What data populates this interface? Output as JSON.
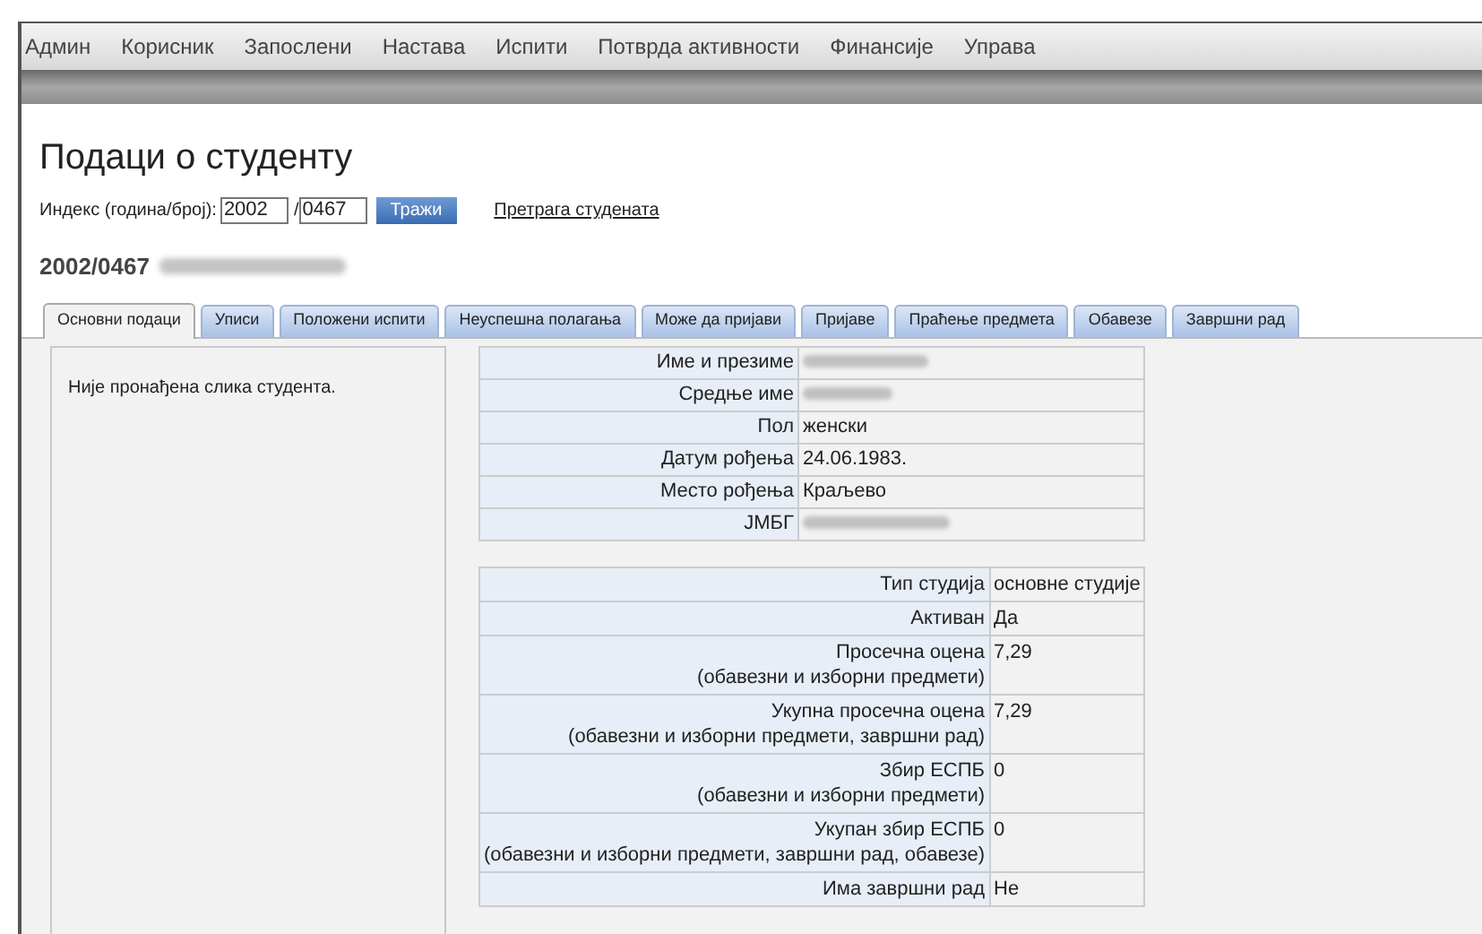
{
  "nav": [
    {
      "label": "Админ"
    },
    {
      "label": "Корисник"
    },
    {
      "label": "Запослени"
    },
    {
      "label": "Настава"
    },
    {
      "label": "Испити"
    },
    {
      "label": "Потврда активности"
    },
    {
      "label": "Финансије"
    },
    {
      "label": "Управа"
    }
  ],
  "title": "Подаци о студенту",
  "search": {
    "label": "Индекс (година/број):",
    "year": "2002",
    "separator": "/",
    "number": "0467",
    "button": "Тражи",
    "link": "Претрага студената"
  },
  "student": {
    "index": "2002/0467",
    "name_redacted": true
  },
  "tabs": [
    {
      "label": "Основни подаци",
      "selected": true
    },
    {
      "label": "Уписи",
      "selected": false
    },
    {
      "label": "Положени испити",
      "selected": false
    },
    {
      "label": "Неуспешна полагања",
      "selected": false
    },
    {
      "label": "Може да пријави",
      "selected": false
    },
    {
      "label": "Пријаве",
      "selected": false
    },
    {
      "label": "Праћење предмета",
      "selected": false
    },
    {
      "label": "Обавезе",
      "selected": false
    },
    {
      "label": "Завршни рад",
      "selected": false
    }
  ],
  "photo_panel": {
    "message": "Није пронађена слика студента."
  },
  "personal": [
    {
      "label": "Име и презиме",
      "redacted": true
    },
    {
      "label": "Средње име",
      "redacted": true
    },
    {
      "label": "Пол",
      "value": "женски",
      "redacted": false
    },
    {
      "label": "Датум рођења",
      "value": "24.06.1983.",
      "redacted": false
    },
    {
      "label": "Место рођења",
      "value": "Краљево",
      "redacted": false
    },
    {
      "label": "ЈМБГ",
      "redacted": true
    }
  ],
  "studies": [
    {
      "label": "Тип студија",
      "value": "основне студије"
    },
    {
      "label": "Активан",
      "value": "Да"
    },
    {
      "label": "Просечна оцена",
      "note": "(обавезни и изборни предмети)",
      "value": "7,29"
    },
    {
      "label": "Укупна просечна оцена",
      "note": "(обавезни и изборни предмети, завршни рад)",
      "value": "7,29"
    },
    {
      "label": "Збир ЕСПБ",
      "note": "(обавезни и изборни предмети)",
      "value": "0"
    },
    {
      "label": "Укупан збир ЕСПБ",
      "note": "(обавезни и изборни предмети, завршни рад, обавезе)",
      "value": "0"
    },
    {
      "label": "Има завршни рад",
      "value": "Не"
    }
  ]
}
